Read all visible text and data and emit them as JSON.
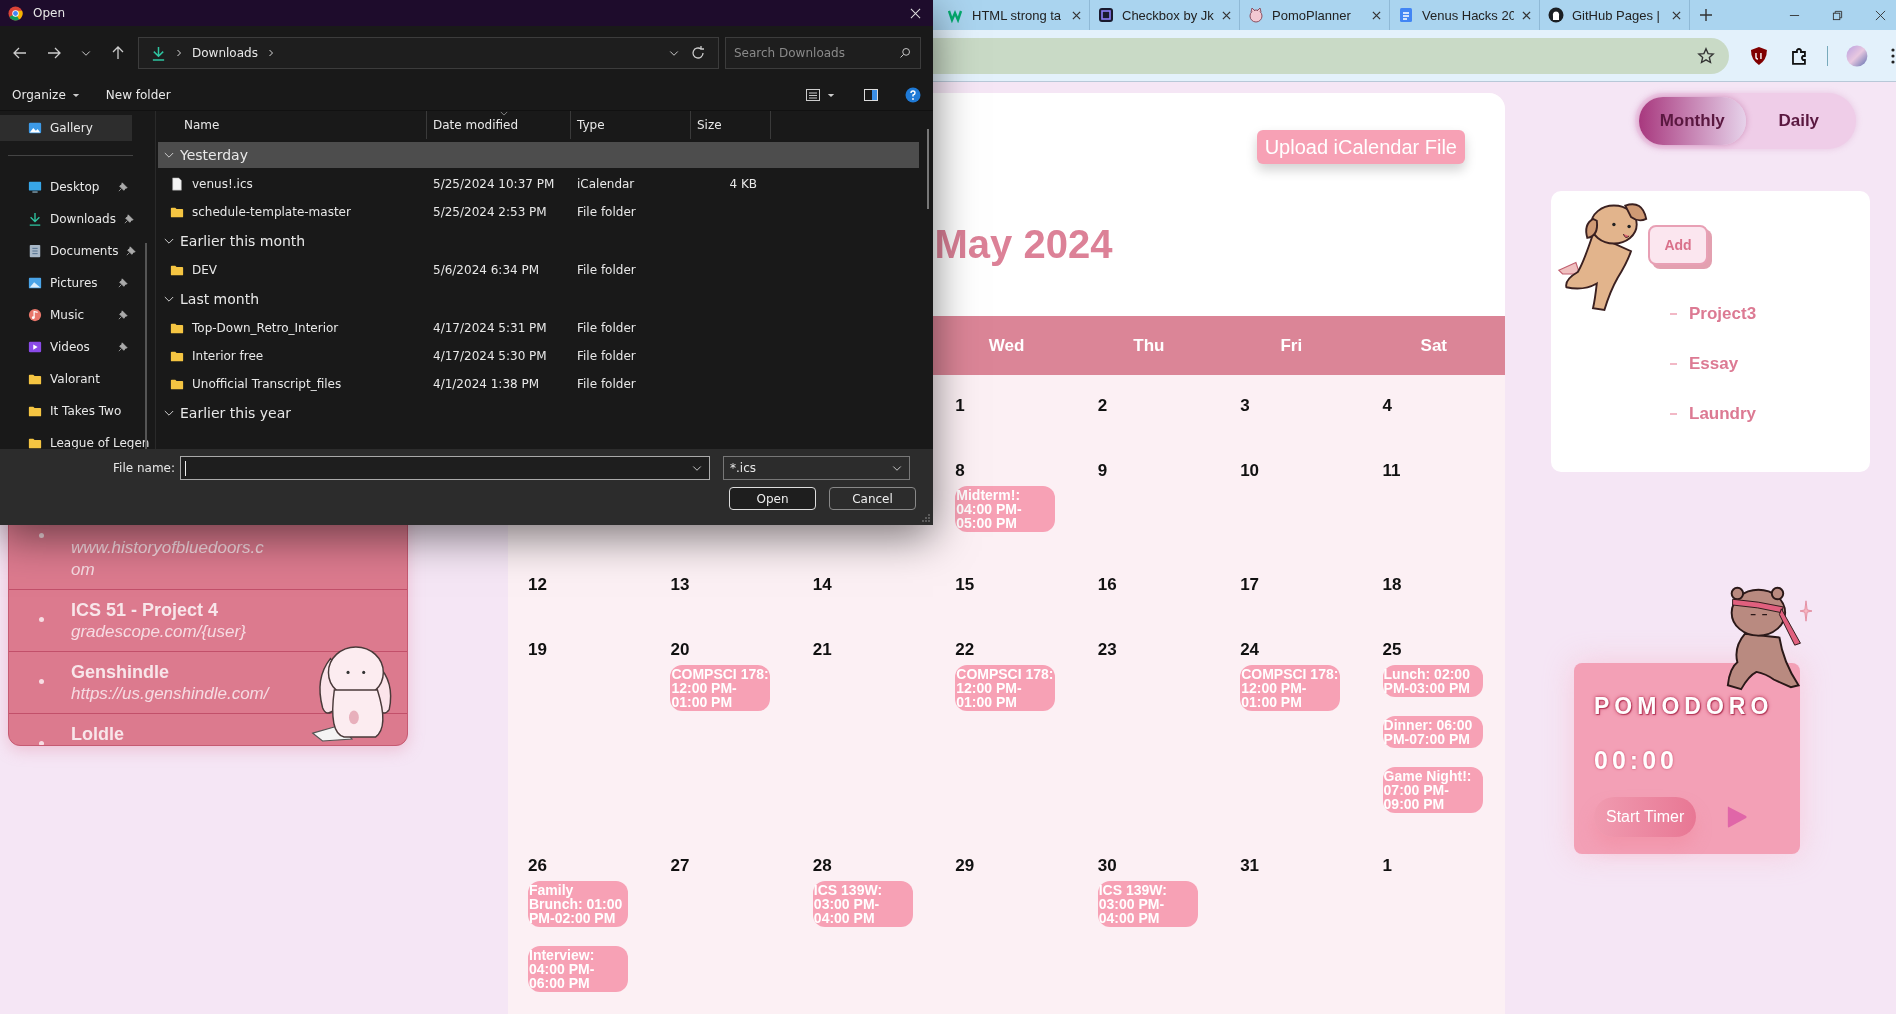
{
  "browser": {
    "tabs": [
      {
        "title": "HTML strong ta",
        "kind": "w3",
        "selected": false
      },
      {
        "title": "Checkbox by Jk",
        "kind": "ui",
        "selected": false
      },
      {
        "title": "PomoPlanner",
        "kind": "pomo",
        "selected": false
      },
      {
        "title": "Venus Hacks 20",
        "kind": "docs",
        "selected": false
      },
      {
        "title": "GitHub Pages |",
        "kind": "github",
        "selected": false
      }
    ]
  },
  "dialog": {
    "title": "Open",
    "path": [
      "Downloads"
    ],
    "search_placeholder": "Search Downloads",
    "organize": "Organize",
    "new_folder": "New folder",
    "nav_items": [
      {
        "label": "Gallery",
        "kind": "gallery",
        "pinned": false,
        "selected": true
      },
      {
        "label": "Desktop",
        "kind": "desktop",
        "pinned": true,
        "selected": false
      },
      {
        "label": "Downloads",
        "kind": "downloads",
        "pinned": true,
        "selected": false
      },
      {
        "label": "Documents",
        "kind": "documents",
        "pinned": true,
        "selected": false
      },
      {
        "label": "Pictures",
        "kind": "pictures",
        "pinned": true,
        "selected": false
      },
      {
        "label": "Music",
        "kind": "music",
        "pinned": true,
        "selected": false
      },
      {
        "label": "Videos",
        "kind": "videos",
        "pinned": true,
        "selected": false
      },
      {
        "label": "Valorant",
        "kind": "folder",
        "pinned": false,
        "selected": false
      },
      {
        "label": "It Takes Two",
        "kind": "folder",
        "pinned": false,
        "selected": false
      },
      {
        "label": "League of Legen",
        "kind": "folder",
        "pinned": false,
        "selected": false
      }
    ],
    "columns": [
      "Name",
      "Date modified",
      "Type",
      "Size"
    ],
    "groups": [
      {
        "label": "Yesterday",
        "selected": true,
        "files": [
          {
            "name": "venus!.ics",
            "kind": "file",
            "date": "5/25/2024 10:37 PM",
            "type": "iCalendar",
            "size": "4 KB"
          },
          {
            "name": "schedule-template-master",
            "kind": "folder",
            "date": "5/25/2024 2:53 PM",
            "type": "File folder"
          }
        ]
      },
      {
        "label": "Earlier this month",
        "selected": false,
        "files": [
          {
            "name": "DEV",
            "kind": "folder",
            "date": "5/6/2024 6:34 PM",
            "type": "File folder"
          }
        ]
      },
      {
        "label": "Last month",
        "selected": false,
        "files": [
          {
            "name": "Top-Down_Retro_Interior",
            "kind": "folder",
            "date": "4/17/2024 5:31 PM",
            "type": "File folder"
          },
          {
            "name": "Interior free",
            "kind": "folder",
            "date": "4/17/2024 5:30 PM",
            "type": "File folder"
          },
          {
            "name": "Unofficial Transcript_files",
            "kind": "folder",
            "date": "4/1/2024 1:38 PM",
            "type": "File folder"
          }
        ]
      },
      {
        "label": "Earlier this year",
        "selected": false
      }
    ],
    "file_name_label": "File name:",
    "file_name_focused": true,
    "filter": "*.ics",
    "open_button": "Open",
    "cancel_button": "Cancel"
  },
  "links": [
    {
      "url": "www.historyofbluedoors.com"
    },
    {
      "title": "ICS 51 - Project 4",
      "url": "gradescope.com/{user}"
    },
    {
      "title": "Genshindle",
      "url": "https://us.genshindle.com/"
    },
    {
      "title": "Loldle"
    }
  ],
  "calendar": {
    "upload_button": "Upload iCalendar File",
    "title": "May 2024",
    "weekdays": [
      "Wed",
      "Thu",
      "Fri",
      "Sat"
    ],
    "weeks": [
      [
        {
          "date": "1"
        },
        {
          "date": "2"
        },
        {
          "date": "3"
        },
        {
          "date": "4"
        }
      ],
      [
        {
          "date": "8",
          "events": [
            "Midterm!: 04:00 PM-05:00 PM"
          ]
        },
        {
          "date": "9"
        },
        {
          "date": "10"
        },
        {
          "date": "11"
        }
      ],
      [
        {
          "date": "12"
        },
        {
          "date": "13"
        },
        {
          "date": "14"
        },
        {
          "date": "15"
        },
        {
          "date": "16"
        },
        {
          "date": "17"
        },
        {
          "date": "18"
        }
      ],
      [
        {
          "date": "19"
        },
        {
          "date": "20",
          "events": [
            "COMPSCI 178: 12:00 PM-01:00 PM"
          ]
        },
        {
          "date": "21"
        },
        {
          "date": "22",
          "events": [
            "COMPSCI 178: 12:00 PM-01:00 PM"
          ]
        },
        {
          "date": "23"
        },
        {
          "date": "24",
          "events": [
            "COMPSCI 178: 12:00 PM-01:00 PM"
          ]
        },
        {
          "date": "25",
          "events": [
            "Lunch: 02:00 PM-03:00 PM",
            "Dinner: 06:00 PM-07:00 PM",
            "Game Night!: 07:00 PM-09:00 PM"
          ]
        }
      ],
      [
        {
          "date": "26",
          "events": [
            "Family Brunch: 01:00 PM-02:00 PM",
            "Interview: 04:00 PM-06:00 PM"
          ]
        },
        {
          "date": "27"
        },
        {
          "date": "28",
          "events": [
            "ICS 139W: 03:00 PM-04:00 PM"
          ]
        },
        {
          "date": "29"
        },
        {
          "date": "30",
          "events": [
            "ICS 139W: 03:00 PM-04:00 PM"
          ]
        },
        {
          "date": "31"
        },
        {
          "date": "1"
        }
      ]
    ]
  },
  "view_toggle": [
    {
      "label": "Monthly",
      "selected": true
    },
    {
      "label": "Daily",
      "selected": false
    }
  ],
  "todo": {
    "add_button": "Add",
    "items": [
      "Project3",
      "Essay",
      "Laundry"
    ]
  },
  "pomodoro": {
    "title": "POMODORO",
    "time": "00:00",
    "start_button": "Start Timer"
  }
}
